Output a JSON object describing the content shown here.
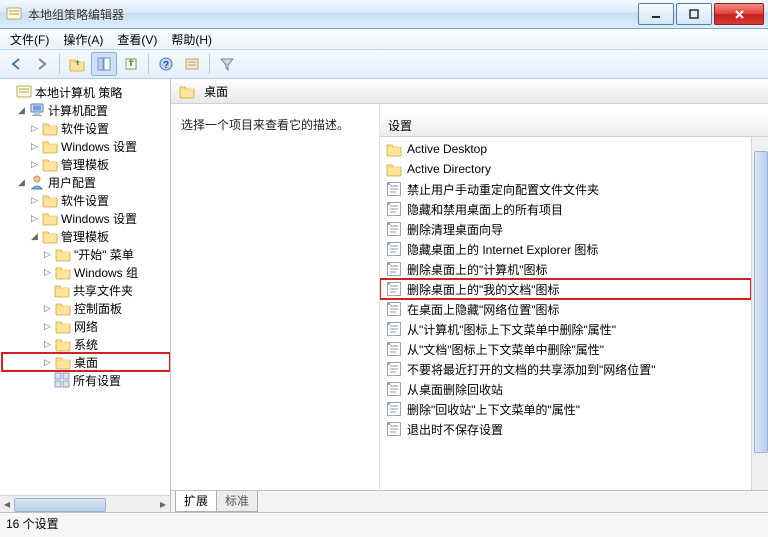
{
  "window_title": "本地组策略编辑器",
  "menu": [
    "文件(F)",
    "操作(A)",
    "查看(V)",
    "帮助(H)"
  ],
  "header_label": "桌面",
  "desc_prompt": "选择一个项目来查看它的描述。",
  "list_header": "设置",
  "tabs": {
    "extended": "扩展",
    "standard": "标准"
  },
  "status": "16 个设置",
  "tree": {
    "root": "本地计算机 策略",
    "computer": "计算机配置",
    "c1": "软件设置",
    "c2": "Windows 设置",
    "c3": "管理模板",
    "user": "用户配置",
    "u1": "软件设置",
    "u2": "Windows 设置",
    "u3": "管理模板",
    "u3a": "\"开始\" 菜单",
    "u3b": "Windows 组",
    "u3c": "共享文件夹",
    "u3d": "控制面板",
    "u3e": "网络",
    "u3f": "系统",
    "u3g": "桌面",
    "u3h": "所有设置"
  },
  "items": [
    {
      "type": "folder",
      "label": "Active Desktop"
    },
    {
      "type": "folder",
      "label": "Active Directory"
    },
    {
      "type": "setting",
      "label": "禁止用户手动重定向配置文件文件夹"
    },
    {
      "type": "setting",
      "label": "隐藏和禁用桌面上的所有项目"
    },
    {
      "type": "setting",
      "label": "删除清理桌面向导"
    },
    {
      "type": "setting",
      "label": "隐藏桌面上的 Internet Explorer 图标"
    },
    {
      "type": "setting",
      "label": "删除桌面上的\"计算机\"图标"
    },
    {
      "type": "setting",
      "label": "删除桌面上的\"我的文档\"图标",
      "hl": true
    },
    {
      "type": "setting",
      "label": "在桌面上隐藏\"网络位置\"图标"
    },
    {
      "type": "setting",
      "label": "从\"计算机\"图标上下文菜单中删除\"属性\""
    },
    {
      "type": "setting",
      "label": "从\"文档\"图标上下文菜单中删除\"属性\""
    },
    {
      "type": "setting",
      "label": "不要将最近打开的文档的共享添加到\"网络位置\""
    },
    {
      "type": "setting",
      "label": "从桌面删除回收站"
    },
    {
      "type": "setting",
      "label": "删除\"回收站\"上下文菜单的\"属性\""
    },
    {
      "type": "setting",
      "label": "退出时不保存设置"
    }
  ]
}
